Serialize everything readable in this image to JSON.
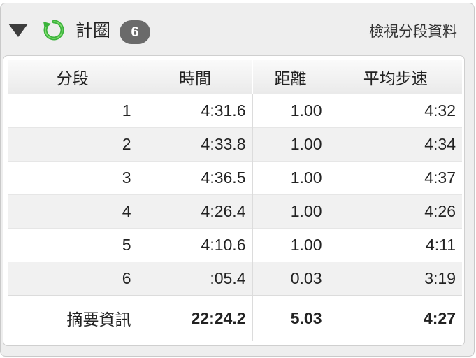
{
  "header": {
    "title": "計圈",
    "lap_count": "6",
    "view_link": "檢視分段資料"
  },
  "table": {
    "columns": [
      "分段",
      "時間",
      "距離",
      "平均步速"
    ],
    "rows": [
      [
        "1",
        "4:31.6",
        "1.00",
        "4:32"
      ],
      [
        "2",
        "4:33.8",
        "1.00",
        "4:34"
      ],
      [
        "3",
        "4:36.5",
        "1.00",
        "4:37"
      ],
      [
        "4",
        "4:26.4",
        "1.00",
        "4:26"
      ],
      [
        "5",
        "4:10.6",
        "1.00",
        "4:11"
      ],
      [
        "6",
        ":05.4",
        "0.03",
        "3:19"
      ]
    ],
    "summary": [
      "摘要資訊",
      "22:24.2",
      "5.03",
      "4:27"
    ]
  },
  "colors": {
    "badge": "#6a6a6a",
    "refresh_icon": "#3cb33c",
    "panel_bg": "#eeeeee"
  },
  "icons": {
    "collapse": "triangle-down-icon",
    "refresh": "refresh-icon"
  }
}
